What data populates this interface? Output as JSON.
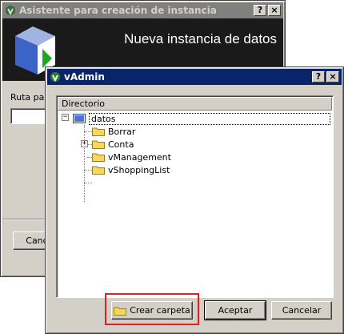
{
  "wizard": {
    "title": "Asistente para creación de instancia",
    "banner_title": "Nueva instancia de datos",
    "path_label": "Ruta par",
    "cancel_label": "Canc",
    "help_btn": "?",
    "close_btn": "×"
  },
  "dialog": {
    "title": "vAdmin",
    "help_btn": "?",
    "close_btn": "×",
    "column_header": "Directorio",
    "tree": {
      "root": "datos",
      "children": [
        "Borrar",
        "Conta",
        "vManagement",
        "vShoppingList"
      ]
    },
    "create_folder_label": "Crear carpeta",
    "accept_label": "Aceptar",
    "cancel_label": "Cancelar"
  },
  "colors": {
    "active_title": "#0a246a",
    "inactive_title": "#808080",
    "highlight_box": "#e02020",
    "selection": "#0a246a"
  }
}
